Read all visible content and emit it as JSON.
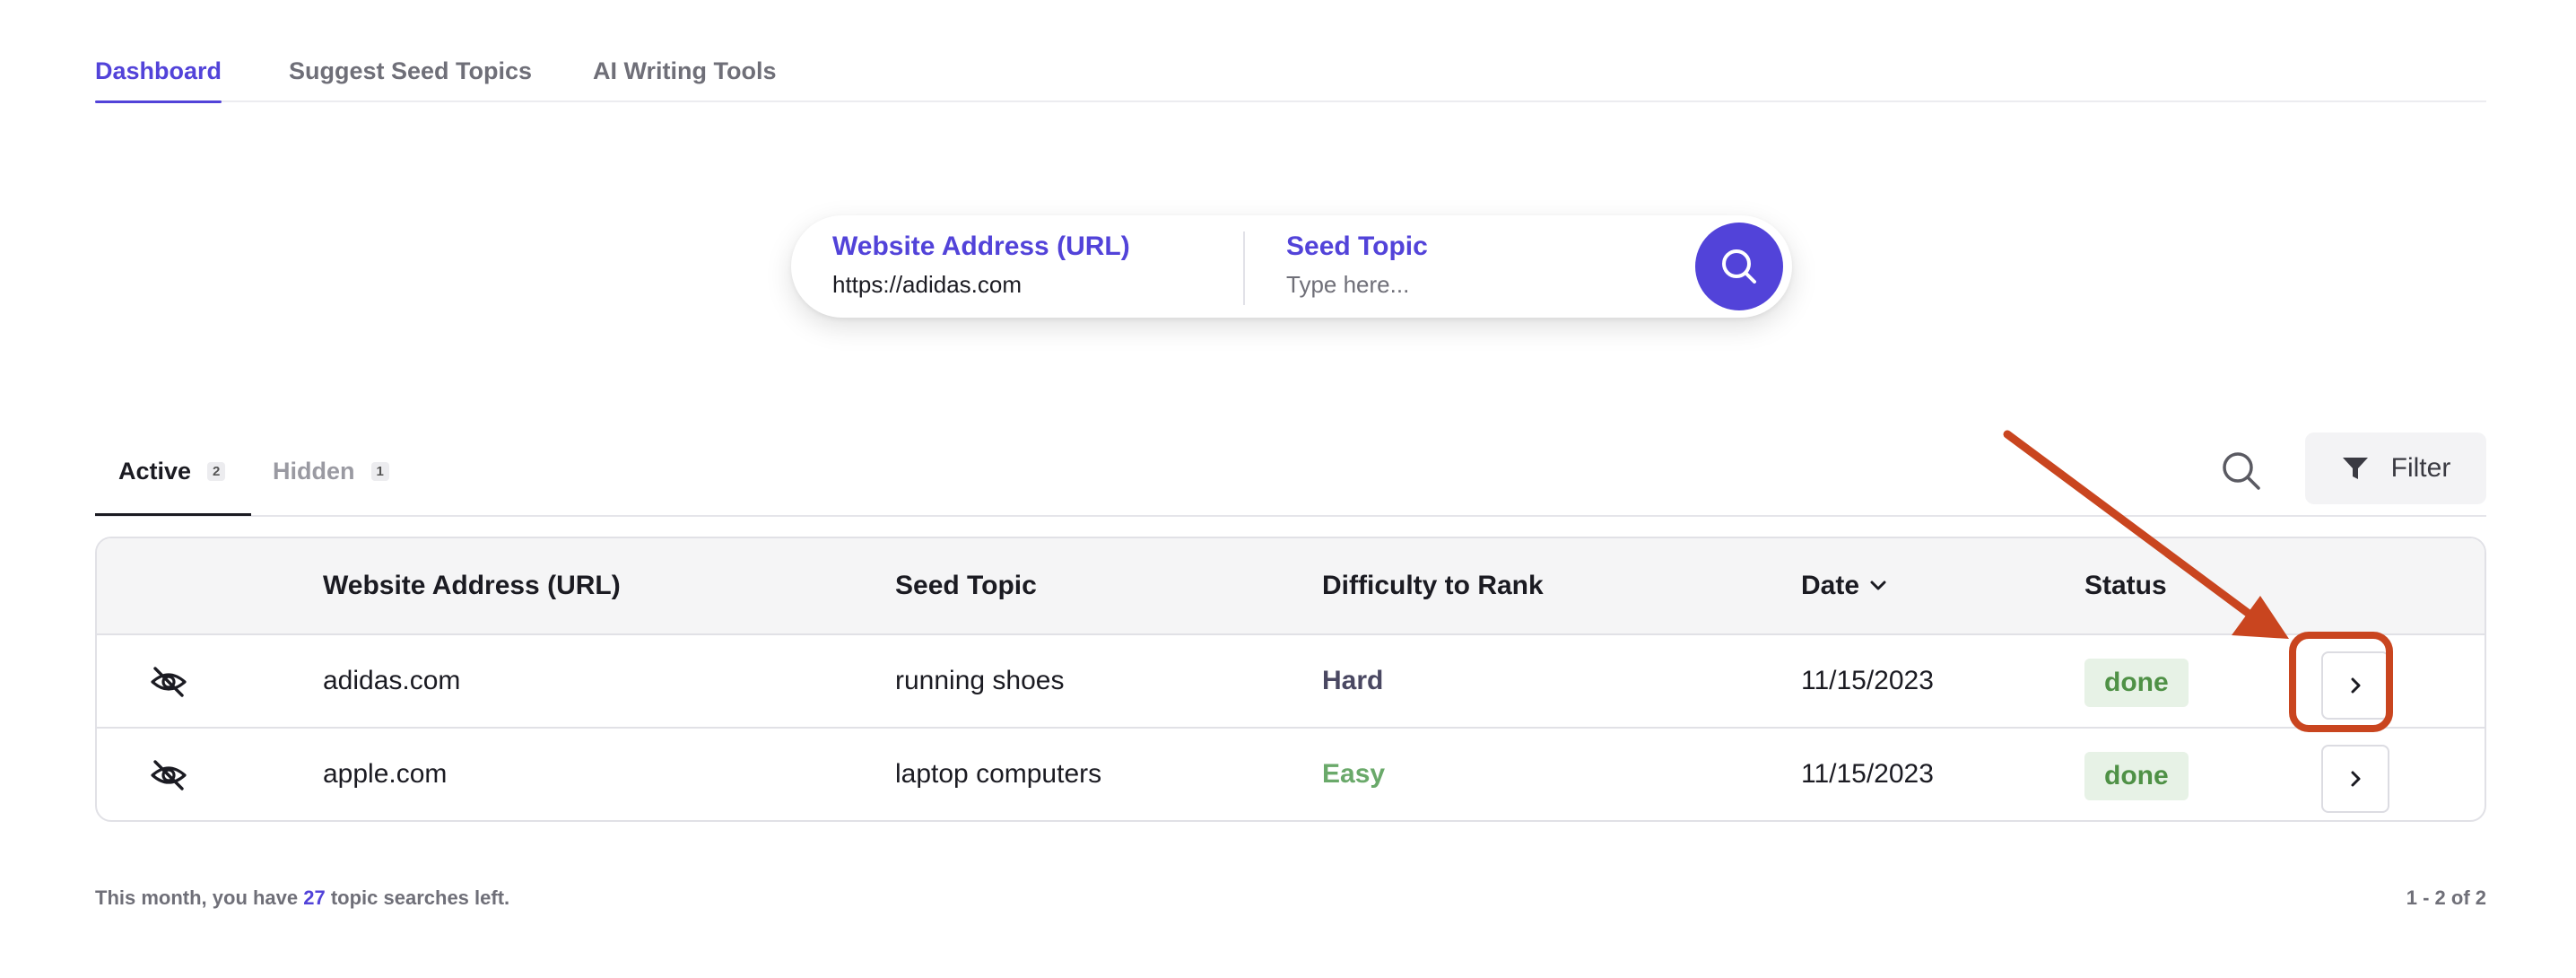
{
  "nav": {
    "tabs": [
      {
        "label": "Dashboard",
        "active": true
      },
      {
        "label": "Suggest Seed Topics",
        "active": false
      },
      {
        "label": "AI Writing Tools",
        "active": false
      }
    ]
  },
  "search": {
    "url_label": "Website Address (URL)",
    "url_value": "https://adidas.com",
    "seed_label": "Seed Topic",
    "seed_placeholder": "Type here...",
    "button_icon": "search-icon"
  },
  "list_tabs": [
    {
      "label": "Active",
      "count": "2",
      "active": true
    },
    {
      "label": "Hidden",
      "count": "1",
      "active": false
    }
  ],
  "toolbar": {
    "filter_label": "Filter",
    "search_icon": "search-icon",
    "filter_icon": "filter-funnel-icon"
  },
  "table": {
    "headers": {
      "url": "Website Address (URL)",
      "seed": "Seed Topic",
      "difficulty": "Difficulty to Rank",
      "date": "Date",
      "status": "Status"
    },
    "rows": [
      {
        "url": "adidas.com",
        "seed": "running shoes",
        "difficulty": "Hard",
        "date": "11/15/2023",
        "status": "done"
      },
      {
        "url": "apple.com",
        "seed": "laptop computers",
        "difficulty": "Easy",
        "date": "11/15/2023",
        "status": "done"
      }
    ]
  },
  "footer": {
    "prefix": "This month, you have ",
    "count": "27",
    "suffix": " topic searches left.",
    "pagination": "1 - 2 of 2"
  },
  "colors": {
    "accent": "#5243d9",
    "hard": "#4a4862",
    "easy": "#6aa96a",
    "status_bg": "#e7f2e6",
    "status_text": "#4f9146",
    "annotation": "#c9451f"
  }
}
